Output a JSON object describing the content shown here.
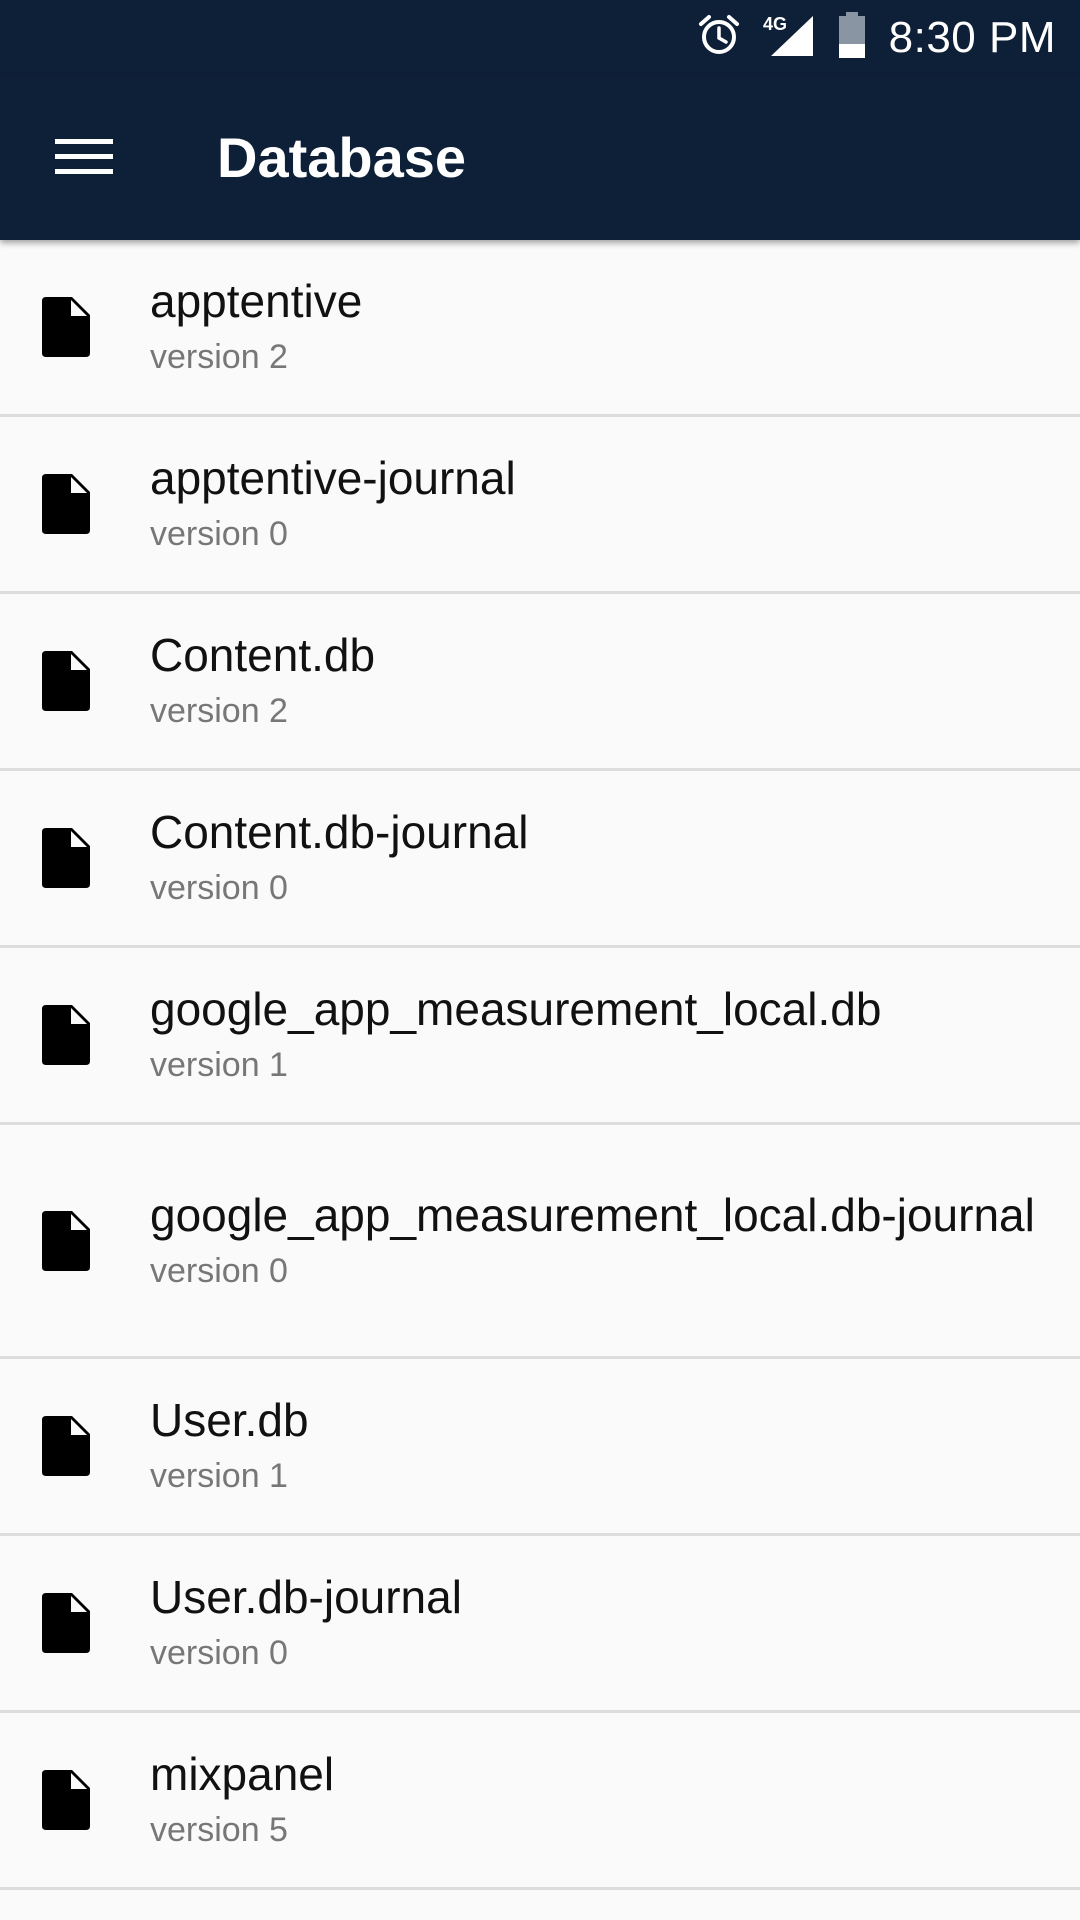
{
  "status_bar": {
    "network_label": "4G",
    "time": "8:30 PM",
    "icons": [
      "alarm-icon",
      "signal-4g-icon",
      "battery-icon"
    ]
  },
  "toolbar": {
    "menu_icon": "hamburger-menu-icon",
    "title": "Database"
  },
  "colors": {
    "toolbar_bg": "#0e2037",
    "list_bg": "#fafafa",
    "divider": "#dddddd",
    "name_text": "#111111",
    "version_text": "#777777"
  },
  "databases": [
    {
      "name": "apptentive",
      "version": "version 2",
      "icon": "file-icon"
    },
    {
      "name": "apptentive-journal",
      "version": "version 0",
      "icon": "file-icon"
    },
    {
      "name": "Content.db",
      "version": "version 2",
      "icon": "file-icon"
    },
    {
      "name": "Content.db-journal",
      "version": "version 0",
      "icon": "file-icon"
    },
    {
      "name": "google_app_measurement_local.db",
      "version": "version 1",
      "icon": "file-icon"
    },
    {
      "name": "google_app_measurement_local.db-journal",
      "version": "version 0",
      "icon": "file-icon"
    },
    {
      "name": "User.db",
      "version": "version 1",
      "icon": "file-icon"
    },
    {
      "name": "User.db-journal",
      "version": "version 0",
      "icon": "file-icon"
    },
    {
      "name": "mixpanel",
      "version": "version 5",
      "icon": "file-icon"
    }
  ]
}
